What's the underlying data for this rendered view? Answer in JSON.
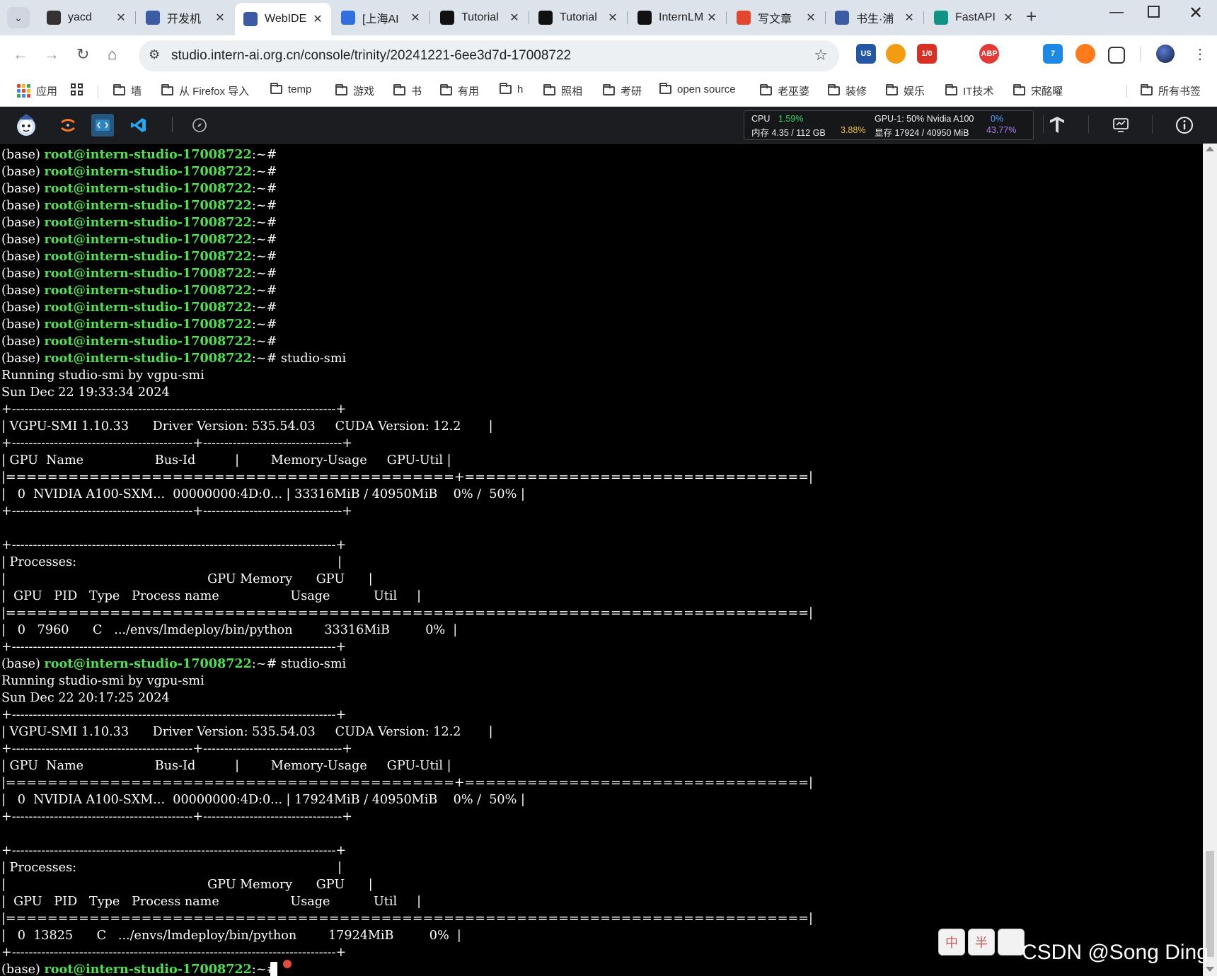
{
  "browser": {
    "tabs": [
      {
        "title": "yacd",
        "color": "#333333"
      },
      {
        "title": "开发机",
        "color": "#3b5ba5"
      },
      {
        "title": "WebIDE",
        "color": "#3b5ba5",
        "active": true
      },
      {
        "title": "[上海AI",
        "color": "#2f6fe0"
      },
      {
        "title": "Tutorial",
        "color": "#111111"
      },
      {
        "title": "Tutorial",
        "color": "#111111"
      },
      {
        "title": "InternLM",
        "color": "#111111"
      },
      {
        "title": "写文章",
        "color": "#e5472e"
      },
      {
        "title": "书生·浦",
        "color": "#3b5ba5"
      },
      {
        "title": "FastAPI",
        "color": "#109383"
      }
    ],
    "tab_close": "✕",
    "new_tab": "+",
    "url": "studio.intern-ai.org.cn/console/trinity/20241221-6ee3d7d-17008722",
    "extensions": [
      "US",
      "",
      "1/0",
      "",
      "ABP",
      "",
      "7",
      "",
      ""
    ],
    "bookmarks": [
      "应用",
      "",
      "墙",
      "从 Firefox 导入",
      "temp",
      "游戏",
      "书",
      "有用",
      "h",
      "照相",
      "考研",
      "open source",
      "老巫婆",
      "装修",
      "娱乐",
      "IT技术",
      "宋酩曜"
    ],
    "all_bookmarks": "所有书签"
  },
  "studio": {
    "cpu_label": "CPU",
    "cpu_value": "1.59%",
    "mem_label": "内存 4.35 / 112 GB",
    "mem_value": "3.88%",
    "gpu_label": "GPU-1: 50% Nvidia A100",
    "gpu_value": "0%",
    "vram_label": "显存 17924 / 40950 MiB",
    "vram_value": "43.77%"
  },
  "terminal": {
    "prompt_prefix": "(base) ",
    "prompt_user": "root@intern-studio-17008722",
    "prompt_suffix": ":~#",
    "lines": [
      {
        "p": true,
        "cmd": ""
      },
      {
        "p": true,
        "cmd": ""
      },
      {
        "p": true,
        "cmd": ""
      },
      {
        "p": true,
        "cmd": ""
      },
      {
        "p": true,
        "cmd": ""
      },
      {
        "p": true,
        "cmd": ""
      },
      {
        "p": true,
        "cmd": ""
      },
      {
        "p": true,
        "cmd": ""
      },
      {
        "p": true,
        "cmd": ""
      },
      {
        "p": true,
        "cmd": ""
      },
      {
        "p": true,
        "cmd": ""
      },
      {
        "p": true,
        "cmd": ""
      },
      {
        "p": true,
        "cmd": " studio-smi"
      },
      {
        "t": "Running studio-smi by vgpu-smi"
      },
      {
        "t": "Sun Dec 22 19:33:34 2024"
      },
      {
        "t": "+-----------------------------------------------------------------------------+"
      },
      {
        "t": "| VGPU-SMI 1.10.33      Driver Version: 535.54.03     CUDA Version: 12.2       |"
      },
      {
        "t": "+-------------------------------------------+---------------------------------+"
      },
      {
        "t": "| GPU  Name                  Bus-Id          |        Memory-Usage     GPU-Util |"
      },
      {
        "t": "|===========================================+=================================|"
      },
      {
        "t": "|   0  NVIDIA A100-SXM...  00000000:4D:0... | 33316MiB / 40950MiB    0% /  50% |"
      },
      {
        "t": "+-------------------------------------------+---------------------------------+"
      },
      {
        "t": ""
      },
      {
        "t": "+-----------------------------------------------------------------------------+"
      },
      {
        "t": "| Processes:                                                                  |"
      },
      {
        "t": "|                                                   GPU Memory      GPU      |"
      },
      {
        "t": "|  GPU   PID   Type   Process name                  Usage           Util     |"
      },
      {
        "t": "|=============================================================================|"
      },
      {
        "t": "|   0   7960      C   .../envs/lmdeploy/bin/python        33316MiB         0%  |"
      },
      {
        "t": "+-----------------------------------------------------------------------------+"
      },
      {
        "p": true,
        "cmd": " studio-smi"
      },
      {
        "t": "Running studio-smi by vgpu-smi"
      },
      {
        "t": "Sun Dec 22 20:17:25 2024"
      },
      {
        "t": "+-----------------------------------------------------------------------------+"
      },
      {
        "t": "| VGPU-SMI 1.10.33      Driver Version: 535.54.03     CUDA Version: 12.2       |"
      },
      {
        "t": "+-------------------------------------------+---------------------------------+"
      },
      {
        "t": "| GPU  Name                  Bus-Id          |        Memory-Usage     GPU-Util |"
      },
      {
        "t": "|===========================================+=================================|"
      },
      {
        "t": "|   0  NVIDIA A100-SXM...  00000000:4D:0... | 17924MiB / 40950MiB    0% /  50% |"
      },
      {
        "t": "+-------------------------------------------+---------------------------------+"
      },
      {
        "t": ""
      },
      {
        "t": "+-----------------------------------------------------------------------------+"
      },
      {
        "t": "| Processes:                                                                  |"
      },
      {
        "t": "|                                                   GPU Memory      GPU      |"
      },
      {
        "t": "|  GPU   PID   Type   Process name                  Usage           Util     |"
      },
      {
        "t": "|=============================================================================|"
      },
      {
        "t": "|   0  13825      C   .../envs/lmdeploy/bin/python        17924MiB         0%  |"
      },
      {
        "t": "+-----------------------------------------------------------------------------+"
      },
      {
        "p": true,
        "cmd": " "
      }
    ]
  },
  "ime": [
    "中",
    "半",
    ""
  ],
  "watermark": "CSDN @Song Ding"
}
